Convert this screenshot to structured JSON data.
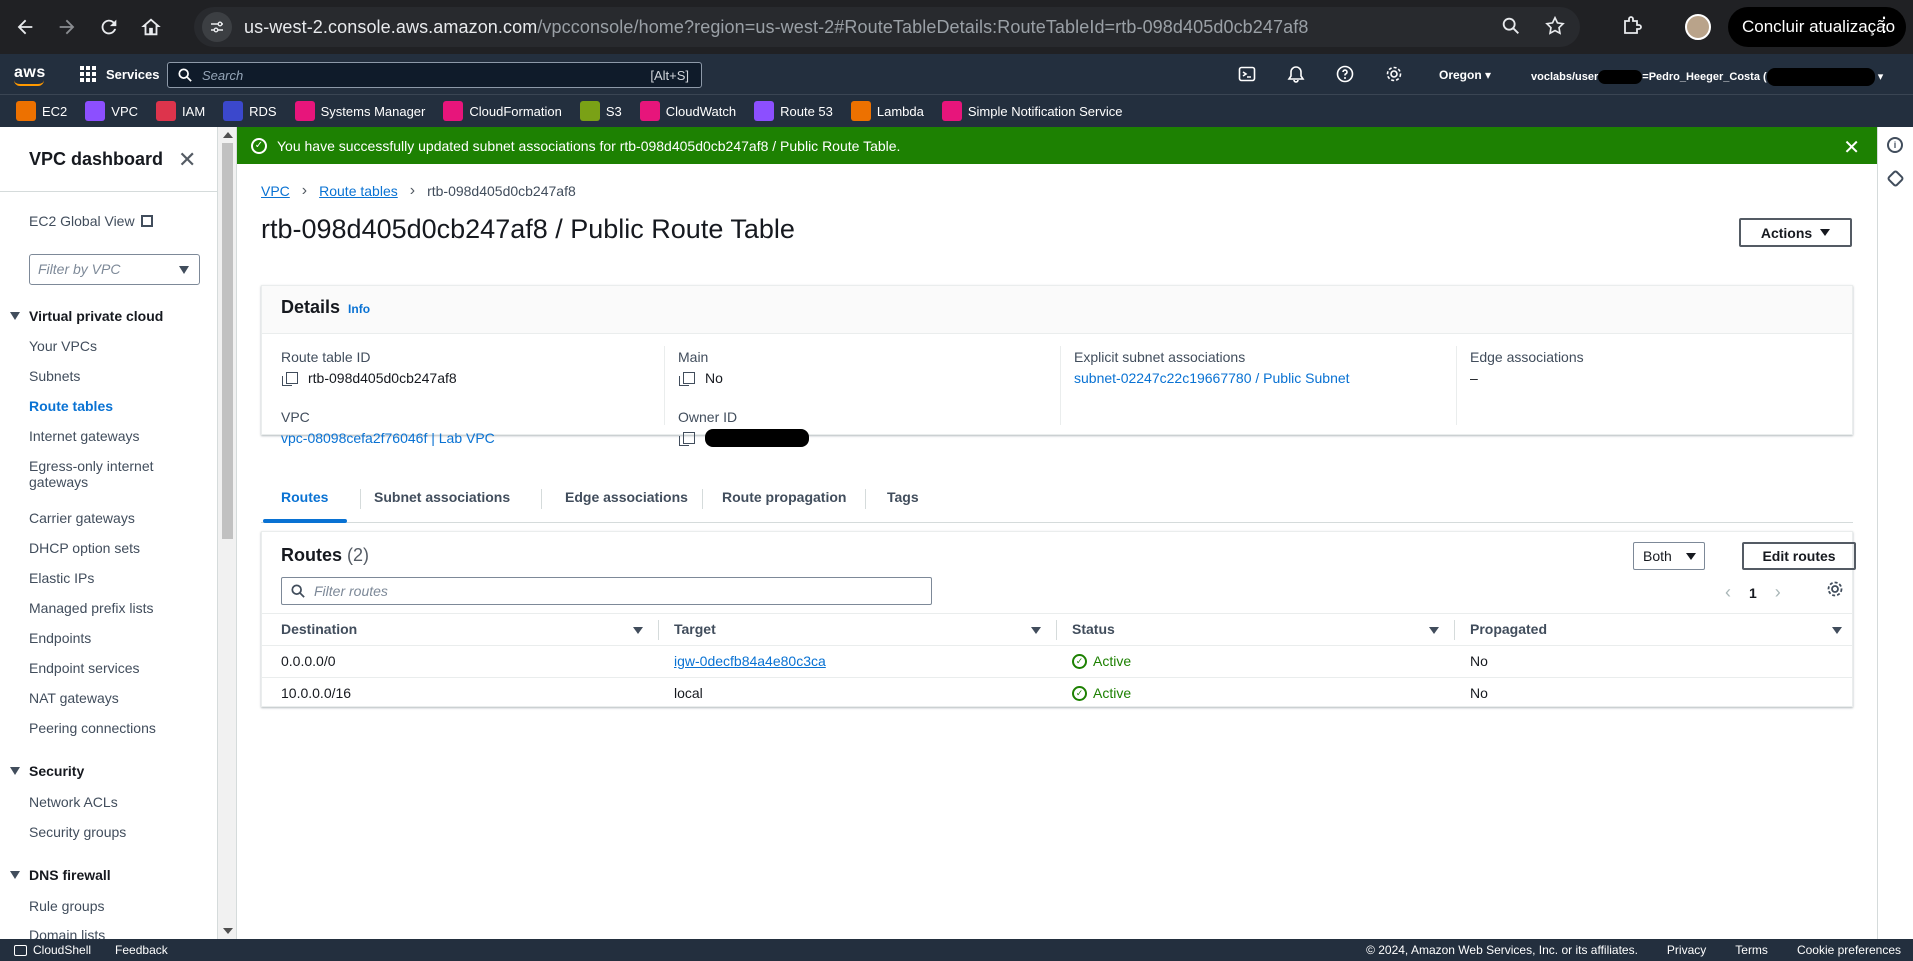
{
  "browser": {
    "url_host": "us-west-2.console.aws.amazon.com",
    "url_path": "/vpcconsole/home?region=us-west-2#RouteTableDetails:RouteTableId=rtb-098d405d0cb247af8",
    "update_label": "Concluir atualização"
  },
  "aws_nav": {
    "logo": "aws",
    "services_label": "Services",
    "search_placeholder": "Search",
    "search_shortcut": "[Alt+S]",
    "region": "Oregon",
    "account_prefix": "voclabs/user",
    "account_name": "=Pedro_Heeger_Costa ("
  },
  "favorites": [
    {
      "label": "EC2",
      "color": "#ed7100"
    },
    {
      "label": "VPC",
      "color": "#8c4fff"
    },
    {
      "label": "IAM",
      "color": "#dd344c"
    },
    {
      "label": "RDS",
      "color": "#3b48cc"
    },
    {
      "label": "Systems Manager",
      "color": "#e7157b"
    },
    {
      "label": "CloudFormation",
      "color": "#e7157b"
    },
    {
      "label": "S3",
      "color": "#7aa116"
    },
    {
      "label": "CloudWatch",
      "color": "#e7157b"
    },
    {
      "label": "Route 53",
      "color": "#8c4fff"
    },
    {
      "label": "Lambda",
      "color": "#ed7100"
    },
    {
      "label": "Simple Notification Service",
      "color": "#e7157b"
    }
  ],
  "sidebar": {
    "title": "VPC dashboard",
    "ec2_global_view": "EC2 Global View",
    "filter_placeholder": "Filter by VPC",
    "section_vpc": "Virtual private cloud",
    "items": [
      "Your VPCs",
      "Subnets",
      "Route tables",
      "Internet gateways",
      "Egress-only internet",
      "gateways",
      "Carrier gateways",
      "DHCP option sets",
      "Elastic IPs",
      "Managed prefix lists",
      "Endpoints",
      "Endpoint services",
      "NAT gateways",
      "Peering connections"
    ],
    "section_security": "Security",
    "security_items": [
      "Network ACLs",
      "Security groups"
    ],
    "section_dns": "DNS firewall",
    "dns_items": [
      "Rule groups",
      "Domain lists"
    ]
  },
  "flash": {
    "message": "You have successfully updated subnet associations for rtb-098d405d0cb247af8 / Public Route Table."
  },
  "breadcrumb": {
    "root": "VPC",
    "parent": "Route tables",
    "current": "rtb-098d405d0cb247af8"
  },
  "page": {
    "title": "rtb-098d405d0cb247af8 / Public Route Table",
    "actions_label": "Actions"
  },
  "details": {
    "heading": "Details",
    "info": "Info",
    "route_table_id_label": "Route table ID",
    "route_table_id": "rtb-098d405d0cb247af8",
    "main_label": "Main",
    "main_value": "No",
    "explicit_label": "Explicit subnet associations",
    "explicit_value": "subnet-02247c22c19667780 / Public Subnet",
    "edge_label": "Edge associations",
    "edge_value": "–",
    "vpc_label": "VPC",
    "vpc_value": "vpc-08098cefa2f76046f | Lab VPC",
    "owner_label": "Owner ID"
  },
  "tabs": [
    "Routes",
    "Subnet associations",
    "Edge associations",
    "Route propagation",
    "Tags"
  ],
  "routes": {
    "title": "Routes",
    "count": "(2)",
    "both_label": "Both",
    "edit_label": "Edit routes",
    "filter_placeholder": "Filter routes",
    "page": "1",
    "columns": [
      "Destination",
      "Target",
      "Status",
      "Propagated"
    ],
    "rows": [
      {
        "destination": "0.0.0.0/0",
        "target": "igw-0decfb84a4e80c3ca",
        "status": "Active",
        "propagated": "No"
      },
      {
        "destination": "10.0.0.0/16",
        "target": "local",
        "status": "Active",
        "propagated": "No"
      }
    ]
  },
  "footer": {
    "cloudshell": "CloudShell",
    "feedback": "Feedback",
    "copyright": "© 2024, Amazon Web Services, Inc. or its affiliates.",
    "privacy": "Privacy",
    "terms": "Terms",
    "cookies": "Cookie preferences"
  }
}
